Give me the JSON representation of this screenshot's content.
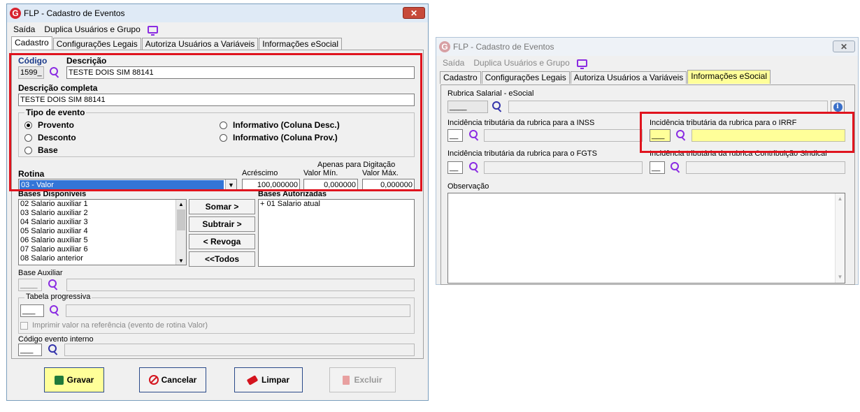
{
  "win1": {
    "title": "FLP - Cadastro de Eventos",
    "menu": [
      "Saída",
      "Duplica Usuários e Grupo"
    ],
    "tabs": [
      "Cadastro",
      "Configurações Legais",
      "Autoriza Usuários a Variáveis",
      "Informações eSocial"
    ],
    "codigo_label": "Código",
    "codigo_value": "1599_",
    "descricao_label": "Descrição",
    "descricao_value": "TESTE DOIS SIM 88141",
    "desc_completa_label": "Descrição completa",
    "desc_completa_value": "TESTE DOIS SIM 88141",
    "tipo_label": "Tipo de evento",
    "tipos": [
      "Provento",
      "Desconto",
      "Base",
      "Informativo (Coluna Desc.)",
      "Informativo (Coluna Prov.)"
    ],
    "tipo_selected": "Provento",
    "rotina_label": "Rotina",
    "rotina_value": "03 - Valor",
    "apenas_label": "Apenas para Digitação",
    "acrescimo_label": "Acréscimo",
    "acrescimo_value": "100,000000",
    "valor_min_label": "Valor Mín.",
    "valor_min_value": "0,000000",
    "valor_max_label": "Valor Máx.",
    "valor_max_value": "0,000000",
    "bases_disp_label": "Bases Disponíveis",
    "bases_disp": [
      "02 Salario auxiliar 1",
      "03 Salario auxiliar 2",
      "04 Salario auxiliar 3",
      "05 Salario auxiliar 4",
      "06 Salario auxiliar 5",
      "07 Salario auxiliar 6",
      "08 Salario anterior"
    ],
    "bases_aut_label": "Bases Autorizadas",
    "bases_aut": [
      "+ 01 Salario atual"
    ],
    "somar": "Somar >",
    "subtrair": "Subtrair >",
    "revoga": "< Revoga",
    "todos": "<<Todos",
    "base_aux_label": "Base Auxiliar",
    "base_aux_value": "____",
    "tabela_label": "Tabela progressiva",
    "tabela_value": "___",
    "imprimir_label": "Imprimir valor na referência (evento de rotina Valor)",
    "cod_interno_label": "Código evento interno",
    "cod_interno_value": "___",
    "gravar": "Gravar",
    "cancelar": "Cancelar",
    "limpar": "Limpar",
    "excluir": "Excluir"
  },
  "win2": {
    "title": "FLP - Cadastro de Eventos",
    "menu": [
      "Saída",
      "Duplica Usuários e Grupo"
    ],
    "tabs": [
      "Cadastro",
      "Configurações Legais",
      "Autoriza Usuários a Variáveis",
      "Informações eSocial"
    ],
    "rubrica_label": "Rubrica Salarial - eSocial",
    "rubrica_value": "____",
    "inss_label": "Incidência tributária da rubrica para a INSS",
    "irrf_label": "Incidência tributária da rubrica para o IRRF",
    "fgts_label": "Incidência tributária da rubrica para o FGTS",
    "sindical_label": "Incidência tributária da rubrica Contribuição Sindical",
    "small_value": "__",
    "irrf_value": "___",
    "observacao_label": "Observação"
  },
  "colors": {
    "highlight": "#e0141e",
    "yellow": "#ffff99",
    "accent": "#8a2be2"
  }
}
